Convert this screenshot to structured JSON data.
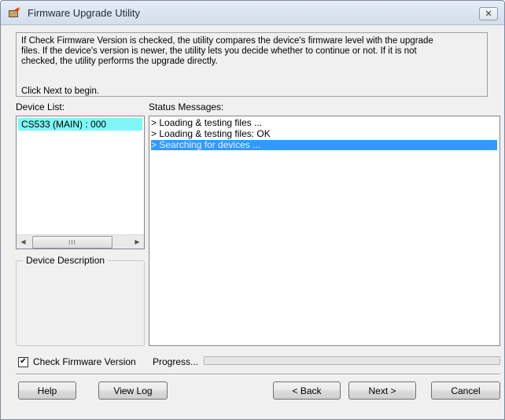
{
  "window": {
    "title": "Firmware Upgrade Utility",
    "close_glyph": "✕"
  },
  "description": {
    "lines": [
      "If Check Firmware Version is checked, the utility compares the device's firmware level with the upgrade",
      "files. If the device's version is newer, the utility lets you decide whether to continue or not. If it is not",
      "checked, the utility performs the upgrade directly."
    ],
    "begin": "Click Next to begin."
  },
  "device_list": {
    "label": "Device List:",
    "items": [
      "CS533 (MAIN) : 000"
    ],
    "scroll_left": "◀",
    "scroll_right": "▶",
    "thumb_grip": "III"
  },
  "device_description": {
    "title": "Device Description"
  },
  "status": {
    "label": "Status Messages:",
    "messages": [
      "> Loading & testing files ...",
      "> Loading & testing files: OK",
      "> Searching for devices ..."
    ],
    "selected_index": 2
  },
  "options": {
    "check_firmware_label": "Check Firmware Version",
    "check_firmware_checked": true,
    "check_glyph": "✔"
  },
  "progress": {
    "label": "Progress...",
    "value_percent": 0
  },
  "buttons": {
    "help": "Help",
    "view_log": "View Log",
    "back": "< Back",
    "next": "Next >",
    "cancel": "Cancel"
  },
  "colors": {
    "selection": "#3399ff",
    "device_highlight": "#7ff5f5"
  }
}
